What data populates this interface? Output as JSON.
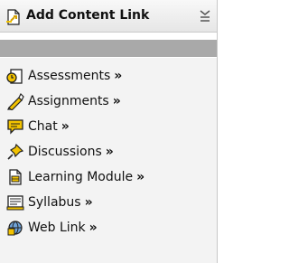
{
  "header": {
    "title": "Add Content Link",
    "icon": "link-page-icon",
    "menu_icon": "menu-toggle-icon"
  },
  "items": [
    {
      "label": "Assessments",
      "arrow": "»",
      "icon": "assessment-icon"
    },
    {
      "label": "Assignments",
      "arrow": "»",
      "icon": "assignment-icon"
    },
    {
      "label": "Chat",
      "arrow": "»",
      "icon": "chat-icon"
    },
    {
      "label": "Discussions",
      "arrow": "»",
      "icon": "discussion-pin-icon"
    },
    {
      "label": "Learning Module",
      "arrow": "»",
      "icon": "learning-module-icon"
    },
    {
      "label": "Syllabus",
      "arrow": "»",
      "icon": "syllabus-icon"
    },
    {
      "label": "Web Link",
      "arrow": "»",
      "icon": "web-link-icon"
    }
  ],
  "colors": {
    "header_bg": "#eeeeee",
    "separator_bar": "#a9a9a9",
    "list_bg": "#f3f3f3",
    "icon_yellow": "#f2c200",
    "icon_outline": "#222222"
  }
}
